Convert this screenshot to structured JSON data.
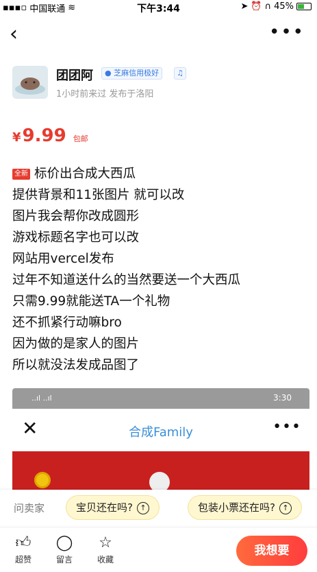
{
  "status_bar": {
    "carrier": "中国联通",
    "time": "下午3:44",
    "battery": "45%"
  },
  "seller": {
    "name": "团团阿",
    "credit_badge": "芝麻信用极好",
    "meta": "1小时前来过  发布于洛阳"
  },
  "price": {
    "symbol": "¥",
    "value": "9.99",
    "shipping": "包邮"
  },
  "description": {
    "tag": "全新",
    "lines": [
      "标价出合成大西瓜",
      "提供背景和11张图片 就可以改",
      "图片我会帮你改成圆形",
      "游戏标题名字也可以改",
      "网站用vercel发布",
      "过年不知道送什么的当然要送一个大西瓜",
      "只需9.99就能送TA一个礼物",
      "还不抓紧行动嘛bro",
      "因为做的是家人的图片",
      "所以就没法发成品图了"
    ]
  },
  "embedded_screenshot": {
    "time": "3:30",
    "title": "合成Family"
  },
  "quick_questions": {
    "label": "问卖家",
    "chips": [
      "宝贝还在吗?",
      "包装小票还在吗?"
    ]
  },
  "bottom_bar": {
    "like_label": "超赞",
    "comment_label": "留言",
    "favorite_label": "收藏",
    "want_label": "我想要"
  },
  "colors": {
    "price_red": "#e63b2e",
    "want_gradient_start": "#ff6a3d",
    "want_gradient_end": "#ff3d3d",
    "chip_bg": "#fff7d0",
    "embed_title_blue": "#3a8fd8"
  }
}
